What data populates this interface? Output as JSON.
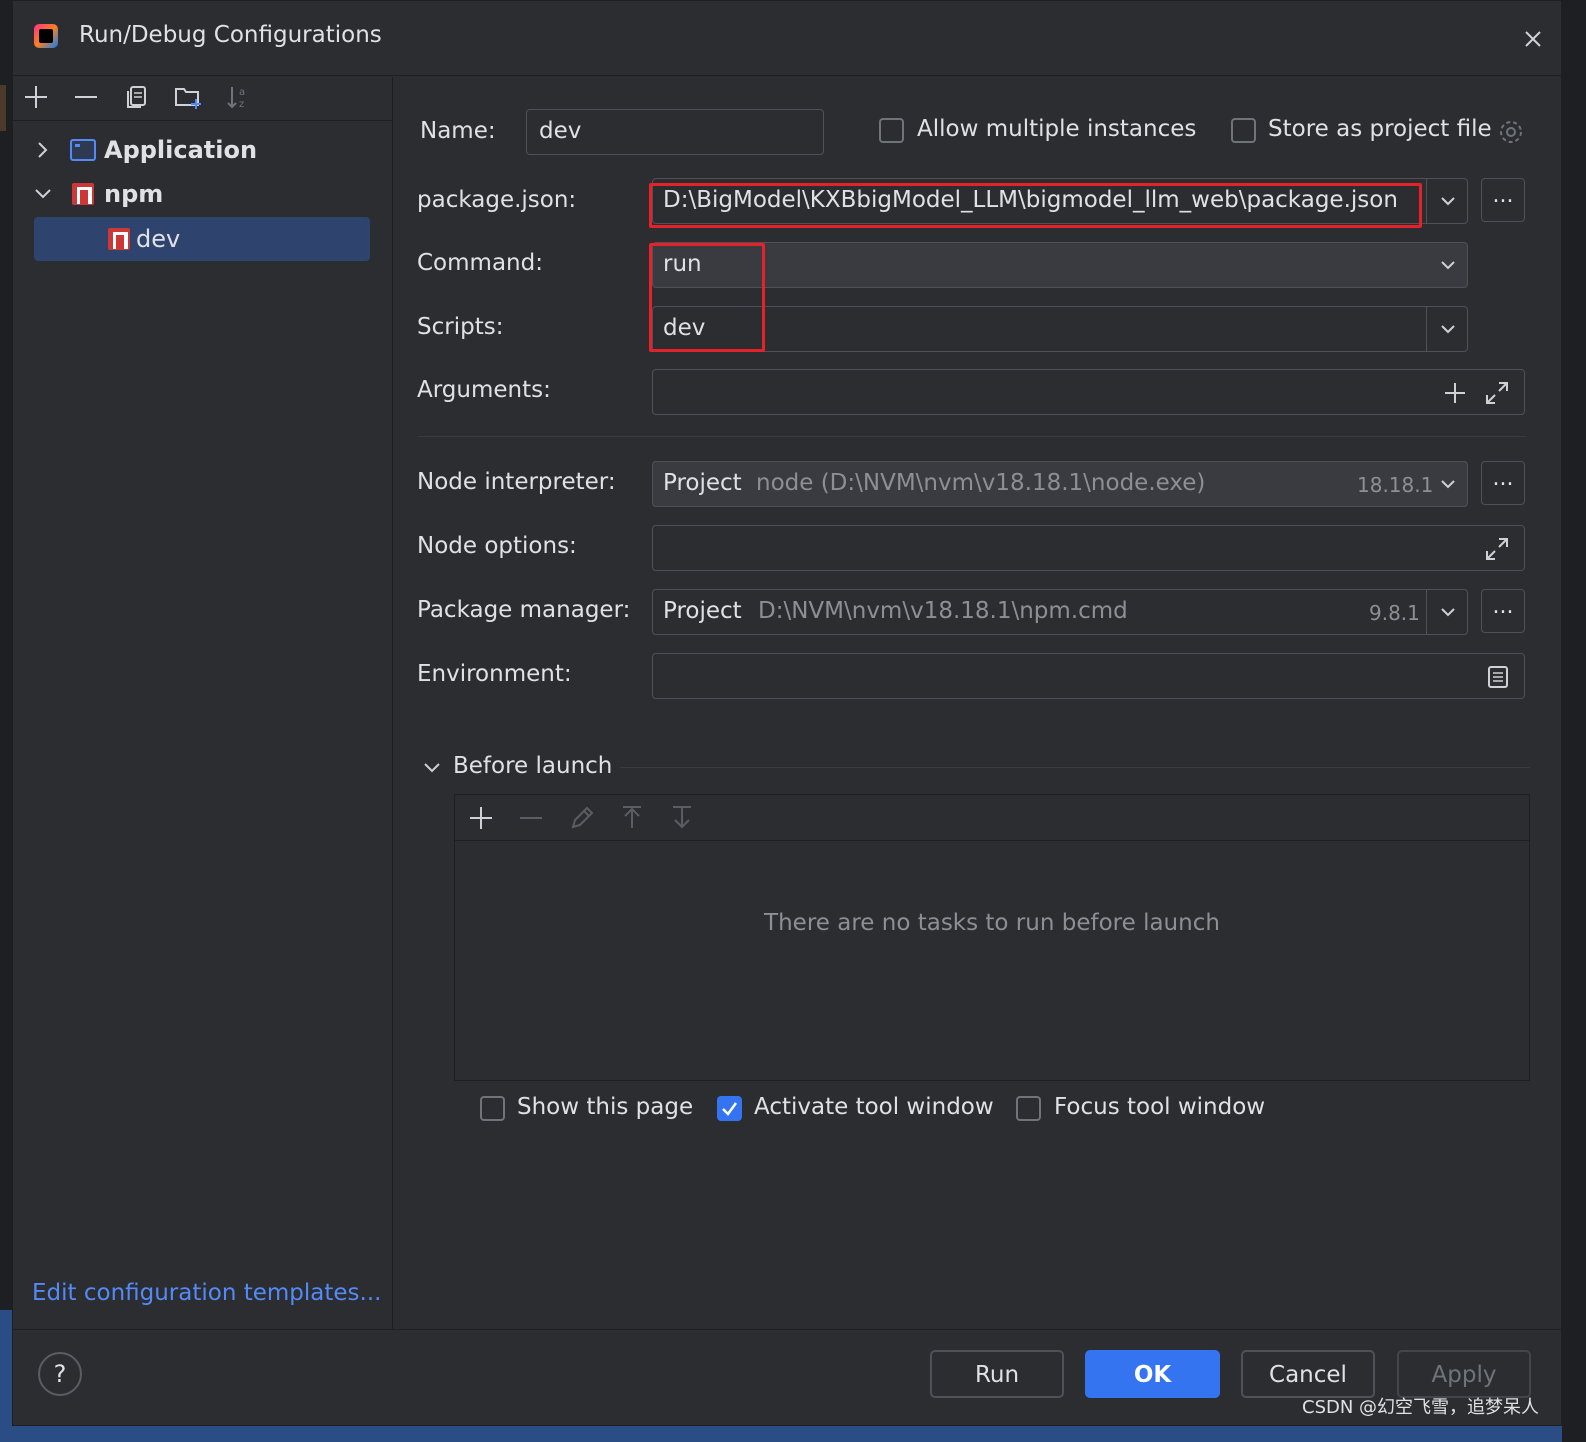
{
  "window": {
    "title": "Run/Debug Configurations"
  },
  "sidebar": {
    "tree": [
      {
        "label": "Application",
        "icon": "application-icon",
        "expanded": false
      },
      {
        "label": "npm",
        "icon": "npm-icon",
        "expanded": true,
        "children": [
          {
            "label": "dev",
            "icon": "npm-icon",
            "selected": true
          }
        ]
      }
    ],
    "edit_templates_link": "Edit configuration templates..."
  },
  "form": {
    "name": {
      "label": "Name:",
      "value": "dev"
    },
    "allow_multiple": {
      "label": "Allow multiple instances",
      "checked": false
    },
    "store_project": {
      "label": "Store as project file",
      "checked": false
    },
    "package_json": {
      "label": "package.json:",
      "value": "D:\\BigModel\\KXBbigModel_LLM\\bigmodel_llm_web\\package.json",
      "browse": "..."
    },
    "command": {
      "label": "Command:",
      "value": "run"
    },
    "scripts": {
      "label": "Scripts:",
      "value": "dev"
    },
    "arguments": {
      "label": "Arguments:",
      "value": ""
    },
    "node_interpreter": {
      "label": "Node interpreter:",
      "prefix": "Project",
      "value": "node (D:\\NVM\\nvm\\v18.18.1\\node.exe)",
      "version": "18.18.1",
      "browse": "..."
    },
    "node_options": {
      "label": "Node options:",
      "value": ""
    },
    "package_manager": {
      "label": "Package manager:",
      "prefix": "Project",
      "value": "D:\\NVM\\nvm\\v18.18.1\\npm.cmd",
      "version": "9.8.1",
      "browse": "..."
    },
    "environment": {
      "label": "Environment:",
      "value": ""
    }
  },
  "before_launch": {
    "title": "Before launch",
    "empty_text": "There are no tasks to run before launch",
    "show_page": {
      "label": "Show this page",
      "checked": false
    },
    "activate_tool_window": {
      "label": "Activate tool window",
      "checked": true
    },
    "focus_tool_window": {
      "label": "Focus tool window",
      "checked": false
    }
  },
  "footer": {
    "help": "?",
    "run": "Run",
    "ok": "OK",
    "cancel": "Cancel",
    "apply": "Apply"
  },
  "watermark": "CSDN @幻空飞雪，追梦呆人",
  "colors": {
    "accent": "#3574f0",
    "link": "#548af7",
    "highlight_box": "#e5222a",
    "selection": "#2e436e",
    "npm": "#cb3837"
  }
}
